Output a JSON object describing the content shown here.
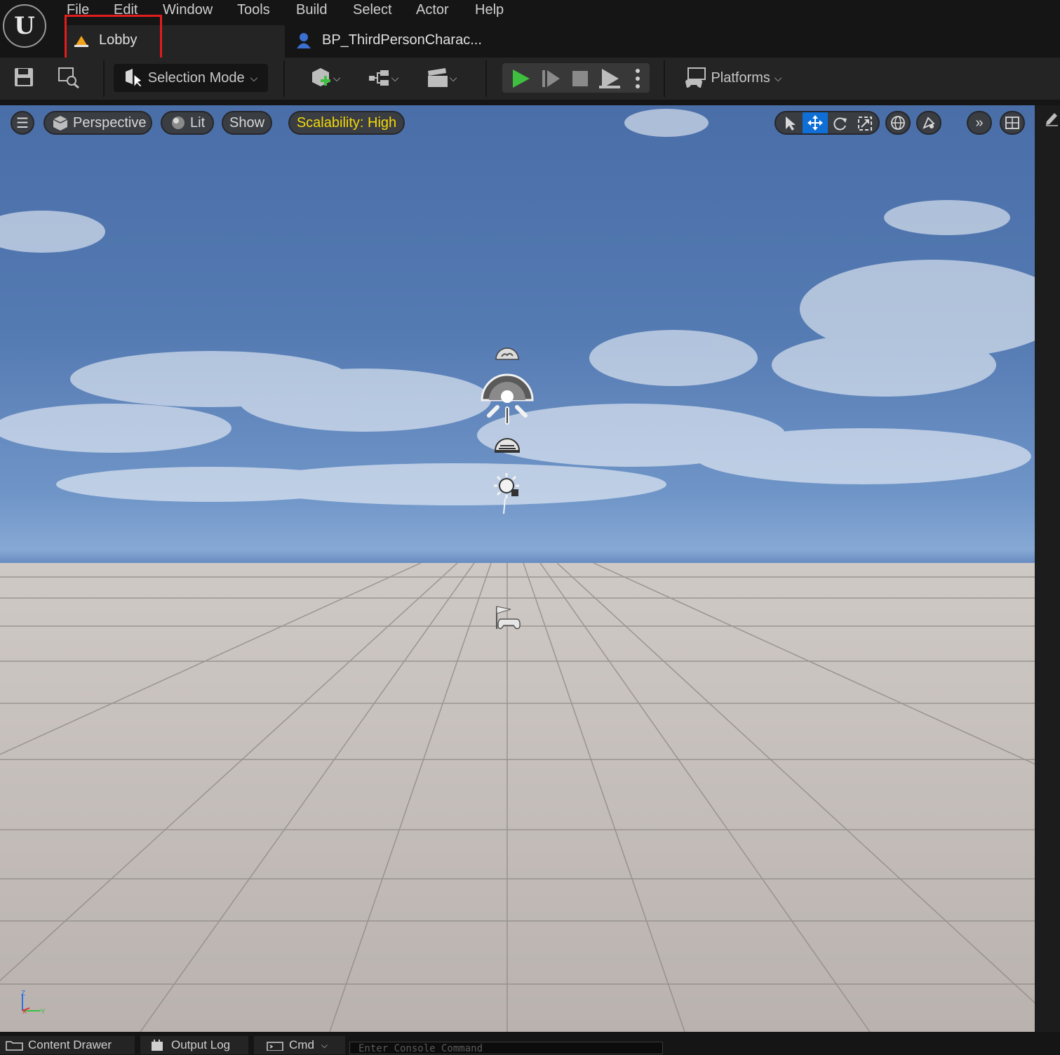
{
  "menu": [
    "File",
    "Edit",
    "Window",
    "Tools",
    "Build",
    "Select",
    "Actor",
    "Help"
  ],
  "tabs": {
    "level_tab": "Lobby",
    "blueprint_tab": "BP_ThirdPersonCharac..."
  },
  "toolbar": {
    "selection_mode": "Selection Mode",
    "platforms": "Platforms"
  },
  "viewport": {
    "perspective": "Perspective",
    "view_mode": "Lit",
    "show": "Show",
    "scalability": "Scalability: High",
    "axis_labels": {
      "z": "Z",
      "x": "X",
      "y": "Y"
    }
  },
  "bottom": {
    "content_drawer": "Content Drawer",
    "output_log": "Output Log",
    "cmd": "Cmd",
    "console_placeholder": "Enter Console Command"
  },
  "colors": {
    "highlight": "#e31c1c",
    "play_green": "#3fbf3f",
    "scalability_text": "#f5d90a",
    "active_transform": "#0f6fd6"
  }
}
